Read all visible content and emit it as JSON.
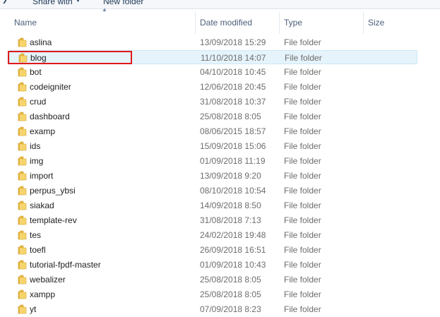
{
  "toolbar": {
    "share_label": "Share with",
    "new_folder_label": "New folder"
  },
  "columns": {
    "name": "Name",
    "date": "Date modified",
    "type": "Type",
    "size": "Size"
  },
  "selected_item": "blog",
  "colors": {
    "selection_bg": "#e5f3fb",
    "annotation_red": "#e01a1a",
    "folder_yellow": "#f2c94c"
  },
  "icons": {
    "folder": "folder-icon",
    "sort": "sort-up-icon",
    "dropdown": "chevron-down-icon"
  },
  "files": [
    {
      "name": "aslina",
      "date": "13/09/2018 15:29",
      "type": "File folder"
    },
    {
      "name": "blog",
      "date": "11/10/2018 14:07",
      "type": "File folder"
    },
    {
      "name": "bot",
      "date": "04/10/2018 10:45",
      "type": "File folder"
    },
    {
      "name": "codeigniter",
      "date": "12/06/2018 20:45",
      "type": "File folder"
    },
    {
      "name": "crud",
      "date": "31/08/2018 10:37",
      "type": "File folder"
    },
    {
      "name": "dashboard",
      "date": "25/08/2018 8:05",
      "type": "File folder"
    },
    {
      "name": "examp",
      "date": "08/06/2015 18:57",
      "type": "File folder"
    },
    {
      "name": "ids",
      "date": "15/09/2018 15:06",
      "type": "File folder"
    },
    {
      "name": "img",
      "date": "01/09/2018 11:19",
      "type": "File folder"
    },
    {
      "name": "import",
      "date": "13/09/2018 9:20",
      "type": "File folder"
    },
    {
      "name": "perpus_ybsi",
      "date": "08/10/2018 10:54",
      "type": "File folder"
    },
    {
      "name": "siakad",
      "date": "14/09/2018 8:50",
      "type": "File folder"
    },
    {
      "name": "template-rev",
      "date": "31/08/2018 7:13",
      "type": "File folder"
    },
    {
      "name": "tes",
      "date": "24/02/2018 19:48",
      "type": "File folder"
    },
    {
      "name": "toefl",
      "date": "26/09/2018 16:51",
      "type": "File folder"
    },
    {
      "name": "tutorial-fpdf-master",
      "date": "01/09/2018 10:43",
      "type": "File folder"
    },
    {
      "name": "webalizer",
      "date": "25/08/2018 8:05",
      "type": "File folder"
    },
    {
      "name": "xampp",
      "date": "25/08/2018 8:05",
      "type": "File folder"
    },
    {
      "name": "yt",
      "date": "07/09/2018 8:23",
      "type": "File folder"
    }
  ]
}
